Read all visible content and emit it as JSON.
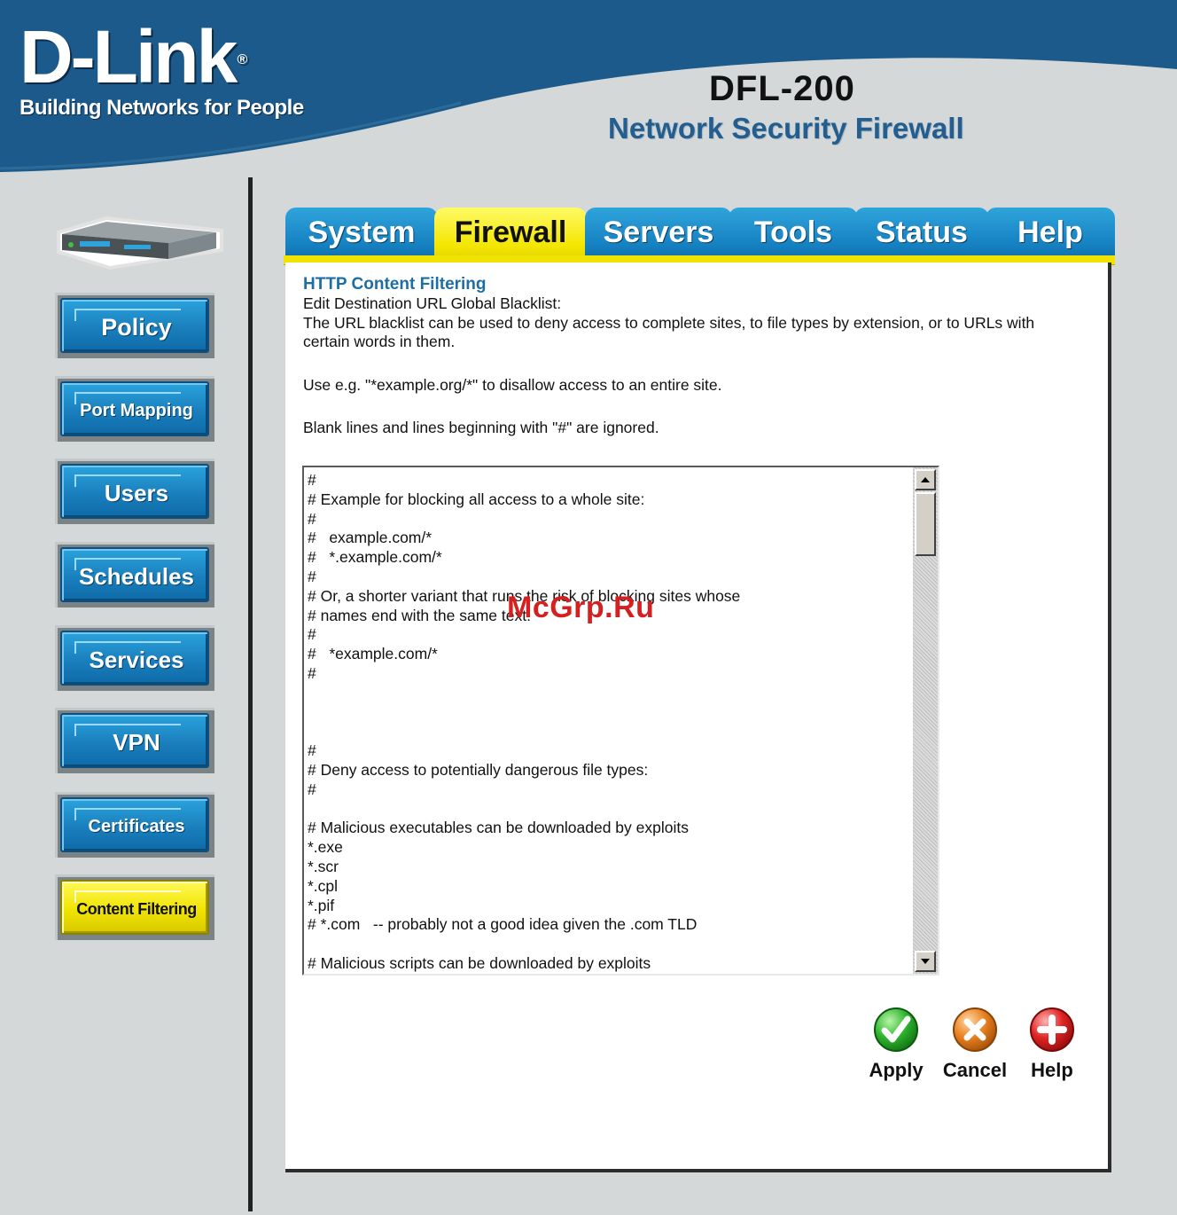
{
  "header": {
    "logo": "D-Link",
    "registered_mark": "®",
    "tagline": "Building Networks for People",
    "model": "DFL-200",
    "product": "Network Security Firewall"
  },
  "tabs": [
    {
      "label": "System",
      "active": false
    },
    {
      "label": "Firewall",
      "active": true
    },
    {
      "label": "Servers",
      "active": false
    },
    {
      "label": "Tools",
      "active": false
    },
    {
      "label": "Status",
      "active": false
    },
    {
      "label": "Help",
      "active": false
    }
  ],
  "sidebar": {
    "items": [
      {
        "label": "Policy",
        "active": false
      },
      {
        "label": "Port Mapping",
        "active": false
      },
      {
        "label": "Users",
        "active": false
      },
      {
        "label": "Schedules",
        "active": false
      },
      {
        "label": "Services",
        "active": false
      },
      {
        "label": "VPN",
        "active": false
      },
      {
        "label": "Certificates",
        "active": false
      },
      {
        "label": "Content Filtering",
        "active": true
      }
    ]
  },
  "content": {
    "title": "HTTP Content Filtering",
    "subtitle": "Edit Destination URL Global Blacklist:",
    "description": "The URL blacklist can be used to deny access to complete sites, to file types by extension, or to URLs with certain words in them.",
    "example_hint": "Use e.g. \"*example.org/*\" to disallow access to an entire site.",
    "ignore_hint": "Blank lines and lines beginning with \"#\" are ignored.",
    "blacklist_text": "#\n# Example for blocking all access to a whole site:\n#\n#   example.com/*\n#   *.example.com/*\n#\n# Or, a shorter variant that runs the risk of blocking sites whose\n# names end with the same text:\n#\n#   *example.com/*\n#\n\n\n\n#\n# Deny access to potentially dangerous file types:\n#\n\n# Malicious executables can be downloaded by exploits\n*.exe\n*.scr\n*.cpl\n*.pif\n# *.com   -- probably not a good idea given the .com TLD\n\n# Malicious scripts can be downloaded by exploits\n*.vbs"
  },
  "actions": {
    "apply_label": "Apply",
    "cancel_label": "Cancel",
    "help_label": "Help"
  },
  "watermark": "McGrp.Ru",
  "colors": {
    "header_blue": "#1b5a8a",
    "tab_blue": "#1580c0",
    "active_yellow": "#f3e600",
    "title_blue": "#1d6ea5",
    "apply_green": "#2fb52f",
    "cancel_orange": "#e8801f",
    "help_red": "#e02424"
  },
  "icons": {
    "apply": "check-circle-icon",
    "cancel": "x-circle-icon",
    "help": "plus-circle-icon"
  }
}
